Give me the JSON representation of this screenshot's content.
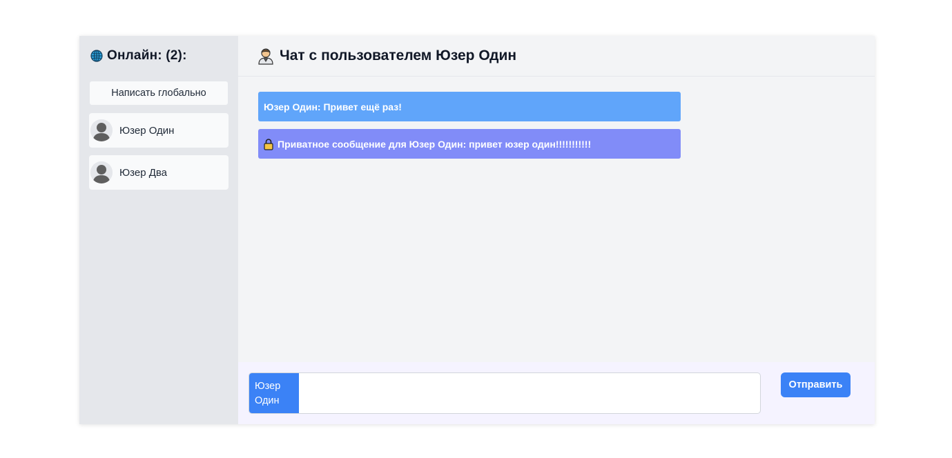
{
  "sidebar": {
    "title": "Онлайн: (2):",
    "global_button": "Написать глобально",
    "users": [
      {
        "name": "Юзер Один"
      },
      {
        "name": "Юзер Два"
      }
    ]
  },
  "chat": {
    "title": "Чат с пользователем Юзер Один",
    "messages": [
      {
        "type": "public",
        "text": "Юзер Один: Привет ещё раз!"
      },
      {
        "type": "private",
        "text": "Приватное сообщение для Юзер Один: привет юзер один!!!!!!!!!!!"
      }
    ]
  },
  "composer": {
    "recipient": "Юзер Один",
    "input_value": "",
    "send_label": "Отправить"
  },
  "colors": {
    "public_message": "#60a5fa",
    "private_message": "#818cf8",
    "accent": "#3b82f6"
  },
  "icons": {
    "online": "globe-icon",
    "chat_header": "person-icon",
    "private": "lock-icon",
    "avatar": "user-silhouette"
  }
}
